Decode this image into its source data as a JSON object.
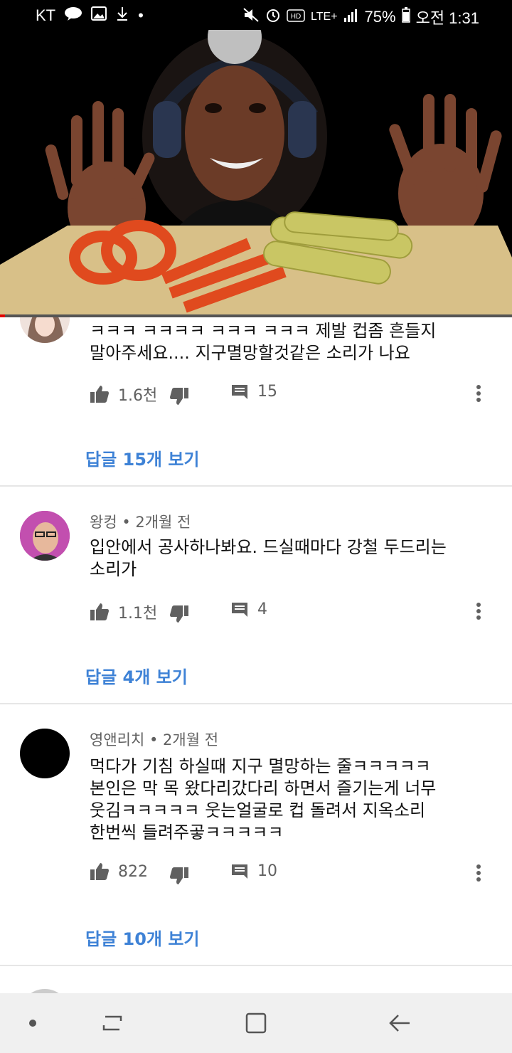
{
  "status_bar": {
    "carrier": "KT",
    "battery": "75%",
    "time": "오전 1:31",
    "network": "LTE+",
    "icons": [
      "kakaotalk-icon",
      "image-icon",
      "download-icon",
      "mute-icon",
      "alarm-icon",
      "hd-voice-icon",
      "signal-icon",
      "battery-icon"
    ]
  },
  "video": {
    "progress": 0.01,
    "progress_color": "#e00000"
  },
  "comments": [
    {
      "author_meta": "",
      "text": "ㅋㅋㅋ ㅋㅋㅋㅋ ㅋㅋㅋ ㅋㅋㅋ  제발 컵좀 흔들지\n말아주세요.... 지구멸망할것같은 소리가 나요",
      "likes": "1.6천",
      "reply_count": "15",
      "view_replies": "답글 15개 보기"
    },
    {
      "author_meta": "왕컹 • 2개월 전",
      "text": "입안에서 공사하나봐요. 드실때마다 강철 두드리는\n소리가",
      "likes": "1.1천",
      "reply_count": "4",
      "view_replies": "답글 4개 보기"
    },
    {
      "author_meta": "영앤리치 • 2개월 전",
      "text": "먹다가 기침 하실때 지구 멸망하는 줄ㅋㅋㅋㅋㅋ\n본인은 막 목 왔다리갔다리 하면서 즐기는게 너무\n웃김ㅋㅋㅋㅋㅋ 웃는얼굴로 컵 돌려서 지옥소리\n한번씩 들려주곻ㅋㅋㅋㅋㅋ",
      "likes": "822",
      "reply_count": "10",
      "view_replies": "답글 10개 보기"
    }
  ],
  "colors": {
    "link": "#3e82d6",
    "meta": "#606060"
  }
}
